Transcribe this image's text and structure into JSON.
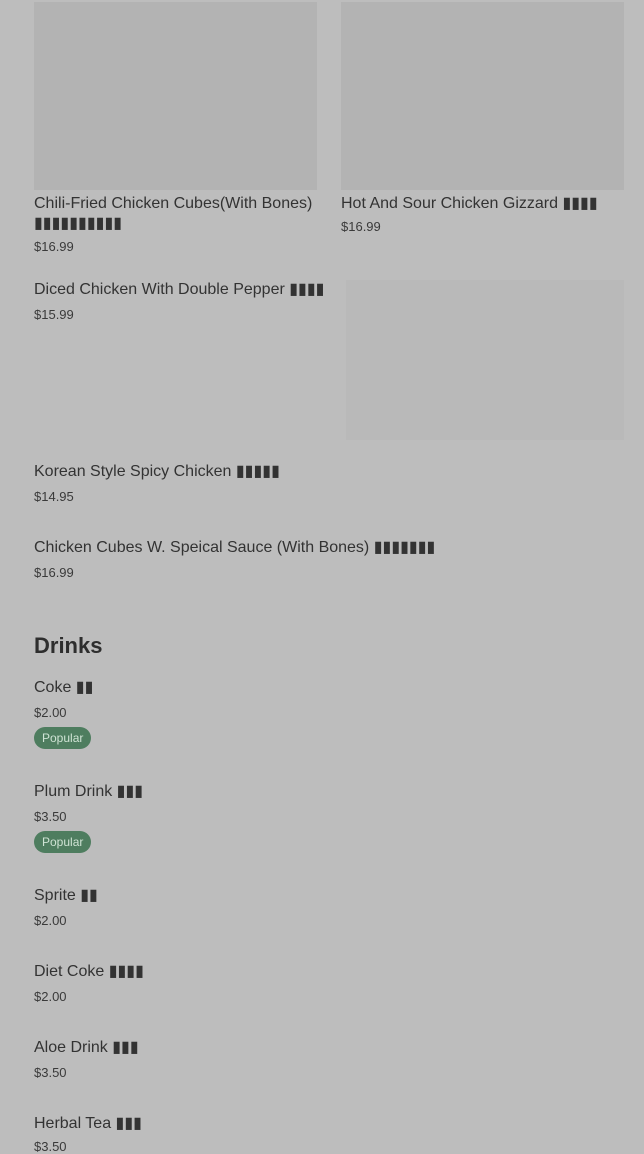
{
  "top_cards": [
    {
      "name": "Chili-Fried Chicken Cubes(With Bones) ▮▮▮▮▮▮▮▮▮▮",
      "price": "$16.99"
    },
    {
      "name": "Hot And Sour Chicken Gizzard ▮▮▮▮",
      "price": "$16.99"
    }
  ],
  "list_items": [
    {
      "name": "Diced Chicken With Double Pepper ▮▮▮▮",
      "price": "$15.99"
    },
    {
      "name": "Korean Style Spicy Chicken ▮▮▮▮▮",
      "price": "$14.95"
    },
    {
      "name": "Chicken Cubes W. Speical Sauce (With Bones) ▮▮▮▮▮▮▮",
      "price": "$16.99"
    }
  ],
  "drinks": {
    "title": "Drinks",
    "items": [
      {
        "name": "Coke ▮▮",
        "price": "$2.00",
        "badge": "Popular"
      },
      {
        "name": "Plum Drink ▮▮▮",
        "price": "$3.50",
        "badge": "Popular"
      },
      {
        "name": "Sprite ▮▮",
        "price": "$2.00"
      },
      {
        "name": "Diet Coke ▮▮▮▮",
        "price": "$2.00"
      },
      {
        "name": "Aloe Drink ▮▮▮",
        "price": "$3.50"
      },
      {
        "name": "Herbal Tea ▮▮▮",
        "price": "$3.50"
      }
    ]
  }
}
